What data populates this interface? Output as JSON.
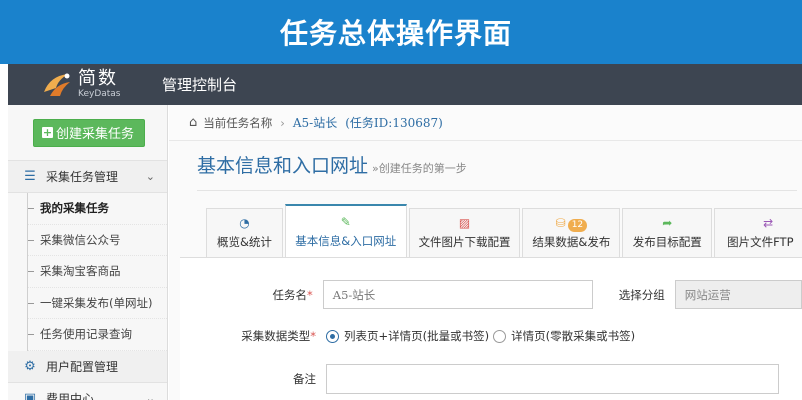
{
  "banner": {
    "title": "任务总体操作界面"
  },
  "navbar": {
    "logo_cn": "简数",
    "logo_en": "KeyDatas",
    "console_label": "管理控制台"
  },
  "sidebar": {
    "create_button": "创建采集任务",
    "group_task": "采集任务管理",
    "sub_items": [
      {
        "label": "我的采集任务"
      },
      {
        "label": "采集微信公众号"
      },
      {
        "label": "采集淘宝客商品"
      },
      {
        "label": "一键采集发布(单网址)"
      },
      {
        "label": "任务使用记录查询"
      }
    ],
    "group_user": "用户配置管理",
    "group_fee": "费用中心"
  },
  "breadcrumb": {
    "prefix": "当前任务名称",
    "separator": "›",
    "task": "A5-站长",
    "task_id": "(任务ID:130687)"
  },
  "page": {
    "title": "基本信息和入口网址",
    "subtitle": "»创建任务的第一步"
  },
  "tabs": [
    {
      "label": "概览&统计",
      "icon": "dashboard-icon"
    },
    {
      "label": "基本信息&入口网址",
      "icon": "edit-icon"
    },
    {
      "label": "文件图片下载配置",
      "icon": "image-icon"
    },
    {
      "label": "结果数据&发布",
      "icon": "database-icon",
      "badge": "12"
    },
    {
      "label": "发布目标配置",
      "icon": "share-icon"
    },
    {
      "label": "图片文件FTP",
      "icon": "exchange-icon"
    }
  ],
  "form": {
    "task_name_label": "任务名",
    "task_name_value": "A5-站长",
    "group_label": "选择分组",
    "group_value": "网站运营",
    "type_label": "采集数据类型",
    "required_mark": "*",
    "type_option_1": "列表页+详情页(批量或书签)",
    "type_option_2": "详情页(零散采集或书签)",
    "note_label": "备注"
  },
  "colors": {
    "banner": "#1a82cc",
    "navbar": "#3d4551",
    "create_button": "#5cb85c",
    "accent": "#2e6da4",
    "badge": "#f0ad4e"
  }
}
